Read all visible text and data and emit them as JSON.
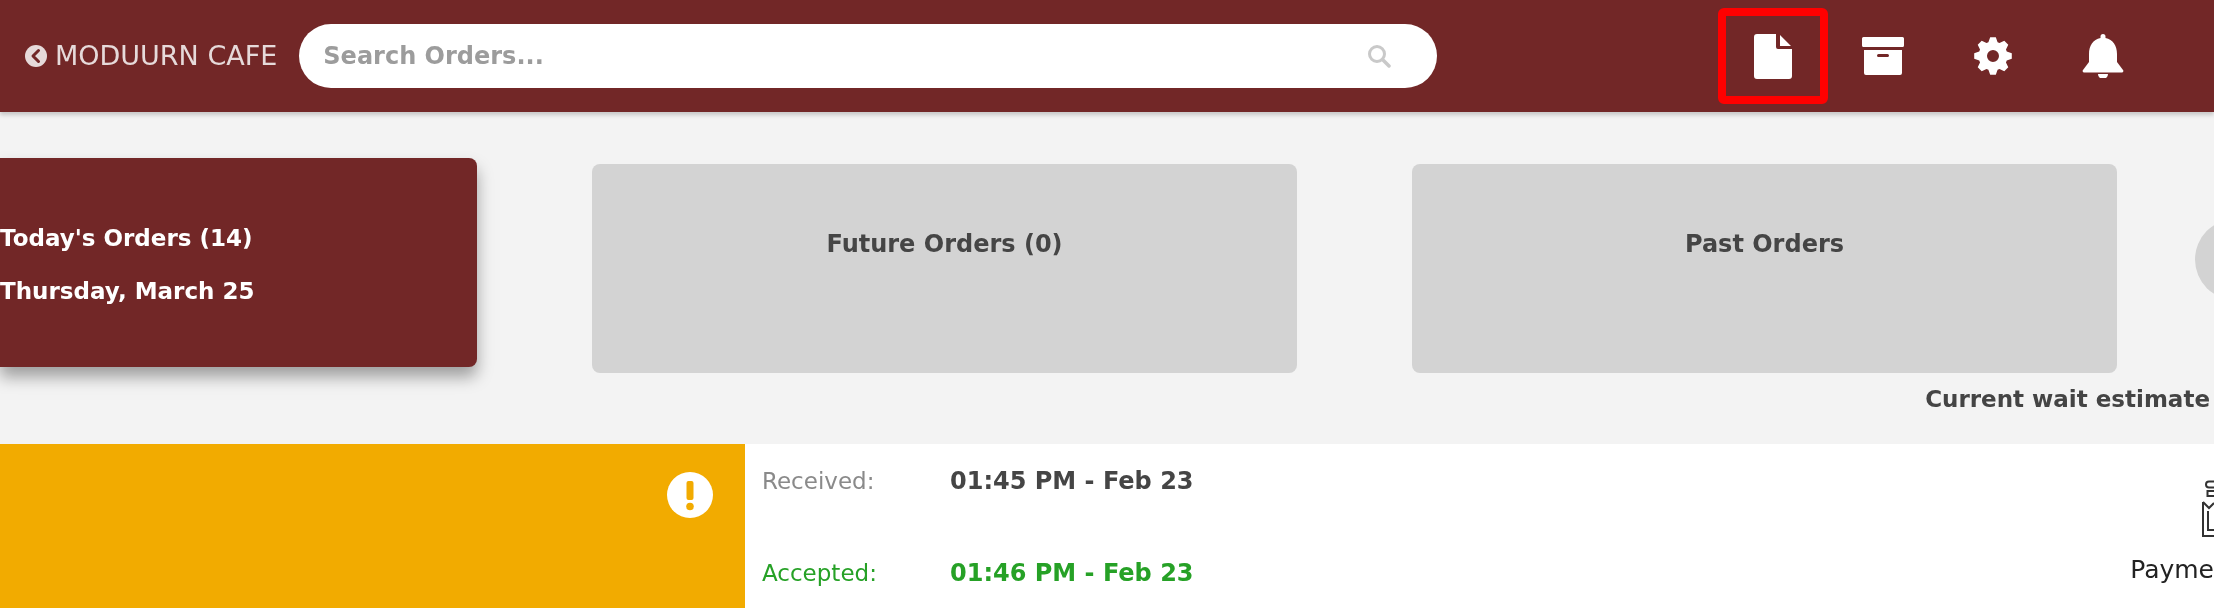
{
  "header": {
    "back_link": {
      "label": "MODUURN CAFE"
    },
    "search": {
      "placeholder": "Search Orders..."
    },
    "toolbar": [
      {
        "highlighted": true
      },
      {
        "highlighted": false
      },
      {
        "highlighted": false
      },
      {
        "highlighted": false
      }
    ]
  },
  "tabs": [
    {
      "label": "Today's Orders (14)",
      "date": "Thursday, March 25",
      "selected": true
    },
    {
      "label": "Future Orders (0)",
      "selected": false
    },
    {
      "label": "Past Orders",
      "selected": false
    }
  ],
  "wait_estimate": {
    "label": "Current wait estimate"
  },
  "order": {
    "kind": "attention",
    "events": [
      {
        "kind": "received",
        "label": "Received:",
        "time": "01:45 PM - Feb 23"
      },
      {
        "kind": "accepted",
        "label": "Accepted:",
        "time": "01:46 PM - Feb 23"
      }
    ],
    "payment": {
      "label": "Payme"
    }
  }
}
